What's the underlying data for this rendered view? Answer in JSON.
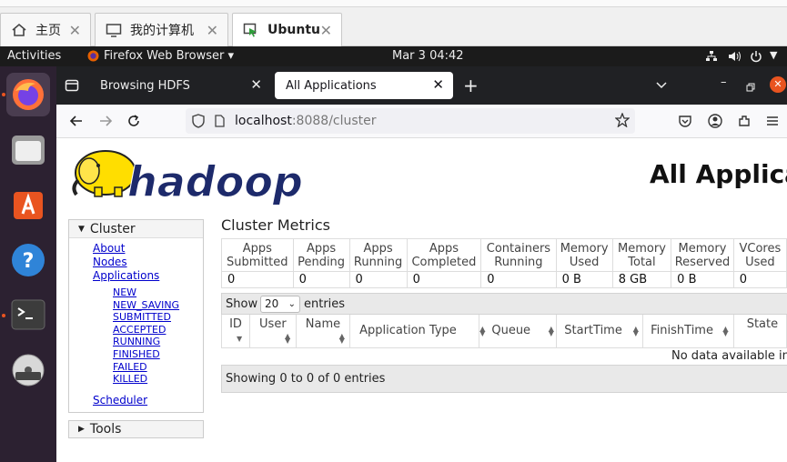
{
  "host_tabs": [
    {
      "label": "主页"
    },
    {
      "label": "我的计算机"
    },
    {
      "label": "Ubuntu"
    }
  ],
  "topbar": {
    "activities": "Activities",
    "app_menu": "Firefox Web Browser ▾",
    "datetime": "Mar 3  04:42"
  },
  "browser": {
    "tabs": [
      {
        "label": "Browsing HDFS"
      },
      {
        "label": "All Applications"
      }
    ],
    "url_host": "localhost",
    "url_rest": ":8088/cluster"
  },
  "page": {
    "logo_text": "hadoop",
    "title": "All Applications",
    "sidebar": {
      "cluster_heading": "Cluster",
      "links": [
        "About",
        "Nodes",
        "Applications"
      ],
      "app_states": [
        "NEW",
        "NEW_SAVING",
        "SUBMITTED",
        "ACCEPTED",
        "RUNNING",
        "FINISHED",
        "FAILED",
        "KILLED"
      ],
      "scheduler": "Scheduler",
      "tools_heading": "Tools"
    },
    "metrics": {
      "title": "Cluster Metrics",
      "headers": [
        [
          "Apps",
          "Submitted"
        ],
        [
          "Apps",
          "Pending"
        ],
        [
          "Apps",
          "Running"
        ],
        [
          "Apps",
          "Completed"
        ],
        [
          "Containers",
          "Running"
        ],
        [
          "Memory",
          "Used"
        ],
        [
          "Memory",
          "Total"
        ],
        [
          "Memory",
          "Reserved"
        ],
        [
          "VCores",
          "Used"
        ]
      ],
      "values": [
        "0",
        "0",
        "0",
        "0",
        "0",
        "0 B",
        "8 GB",
        "0 B",
        "0"
      ]
    },
    "apps_table": {
      "show_label": "Show",
      "page_size": "20",
      "entries_label": "entries",
      "columns": [
        "ID",
        "User",
        "Name",
        "Application Type",
        "Queue",
        "StartTime",
        "FinishTime",
        "State"
      ],
      "empty_message": "No data available in table",
      "info": "Showing 0 to 0 of 0 entries"
    }
  }
}
